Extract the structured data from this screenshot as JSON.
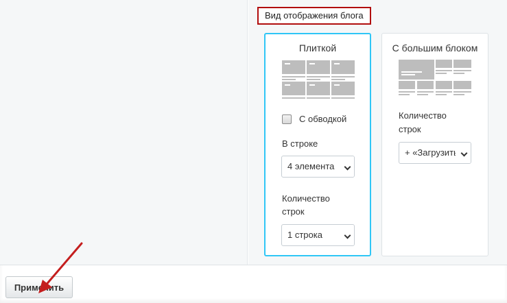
{
  "section": {
    "title": "Вид отображения блога"
  },
  "cards": {
    "tile": {
      "title": "Плиткой",
      "border_checkbox_label": "С обводкой",
      "per_row_label": "В строке",
      "per_row_value": "4 элемента",
      "rows_label_line1": "Количество",
      "rows_label_line2": "строк",
      "rows_value": "1 строка"
    },
    "large": {
      "title": "С большим блоком",
      "rows_label_line1": "Количество",
      "rows_label_line2": "строк",
      "rows_value": "+ «Загрузить"
    }
  },
  "footer": {
    "apply_label": "Применить"
  },
  "colors": {
    "selected_border": "#2fc6f6",
    "header_outline": "#b10d0d",
    "arrow": "#c41e1e"
  }
}
